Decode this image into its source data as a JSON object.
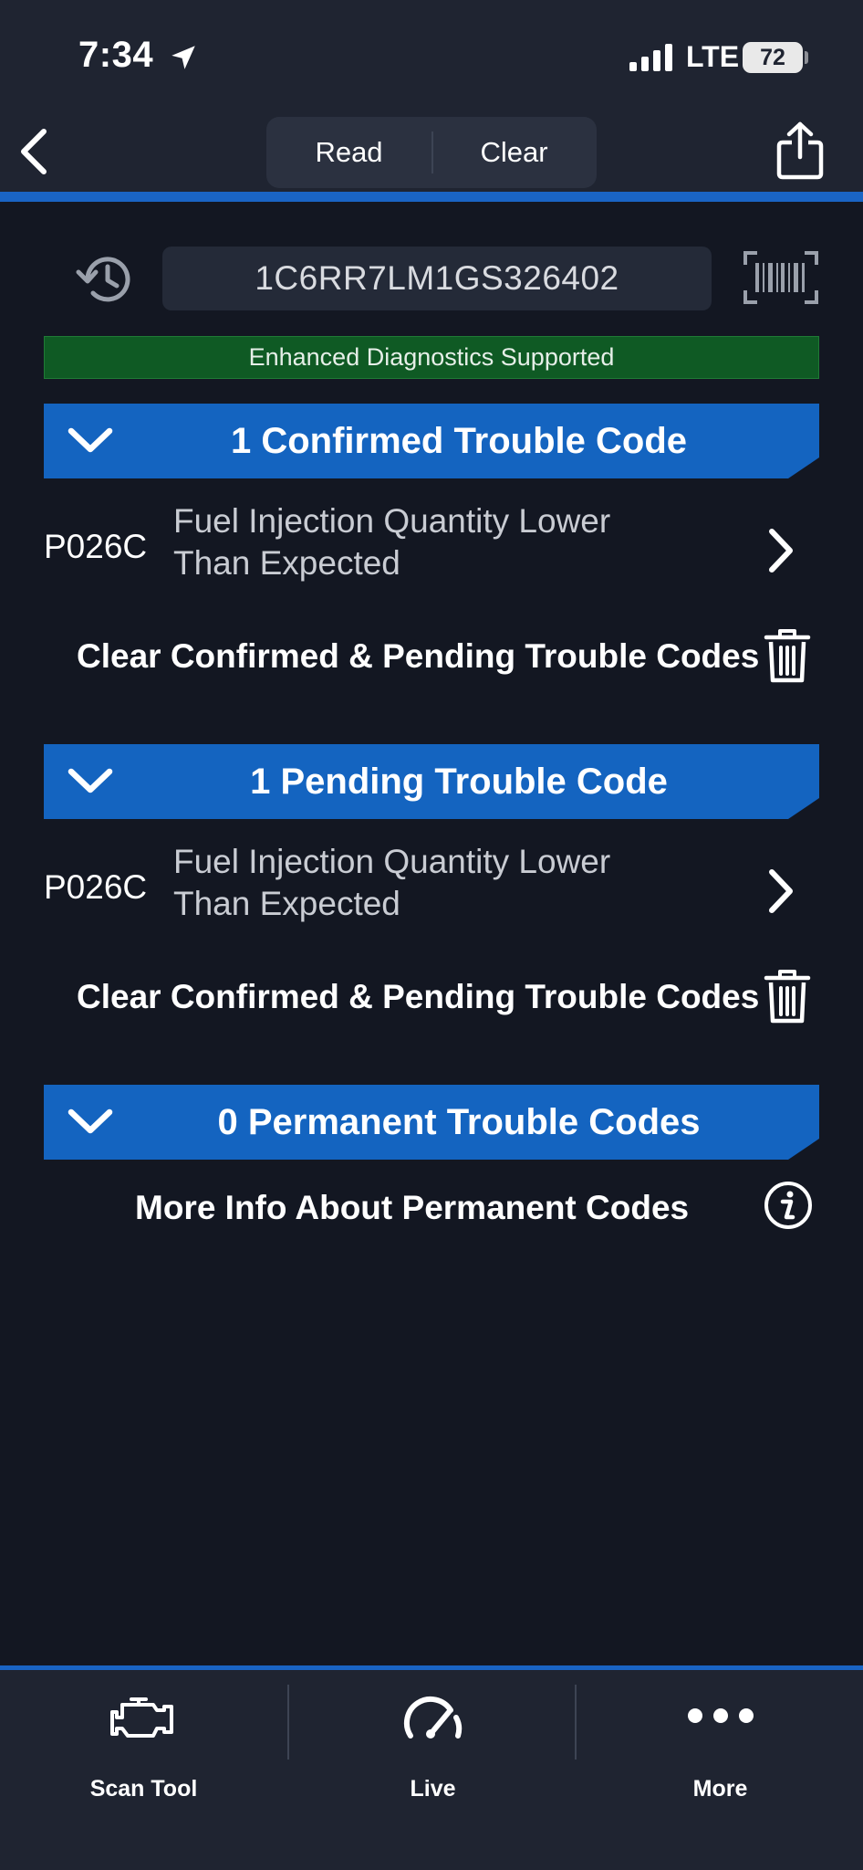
{
  "status": {
    "time": "7:34",
    "network": "LTE",
    "battery": "72"
  },
  "nav": {
    "read_label": "Read",
    "clear_label": "Clear"
  },
  "vin": "1C6RR7LM1GS326402",
  "banner": "Enhanced Diagnostics Supported",
  "sections": {
    "confirmed": {
      "title": "1 Confirmed Trouble Code",
      "code": "P026C",
      "desc_line1": "Fuel Injection Quantity Lower",
      "desc_line2": "Than Expected",
      "clear_label": "Clear Confirmed & Pending Trouble Codes"
    },
    "pending": {
      "title": "1 Pending Trouble Code",
      "code": "P026C",
      "desc_line1": "Fuel Injection Quantity Lower",
      "desc_line2": "Than Expected",
      "clear_label": "Clear Confirmed & Pending Trouble Codes"
    },
    "permanent": {
      "title": "0 Permanent Trouble Codes",
      "info_label": "More Info About Permanent Codes"
    }
  },
  "tabs": [
    {
      "label": "Scan Tool",
      "icon": "engine-icon",
      "active": true
    },
    {
      "label": "Live",
      "icon": "gauge-icon",
      "active": false
    },
    {
      "label": "More",
      "icon": "more-dots-icon",
      "active": false
    }
  ],
  "colors": {
    "background": "#131722",
    "bar": "#1f2431",
    "accent": "#1a64c4",
    "section_header": "#1464c0",
    "banner_green": "#0f5a24"
  }
}
